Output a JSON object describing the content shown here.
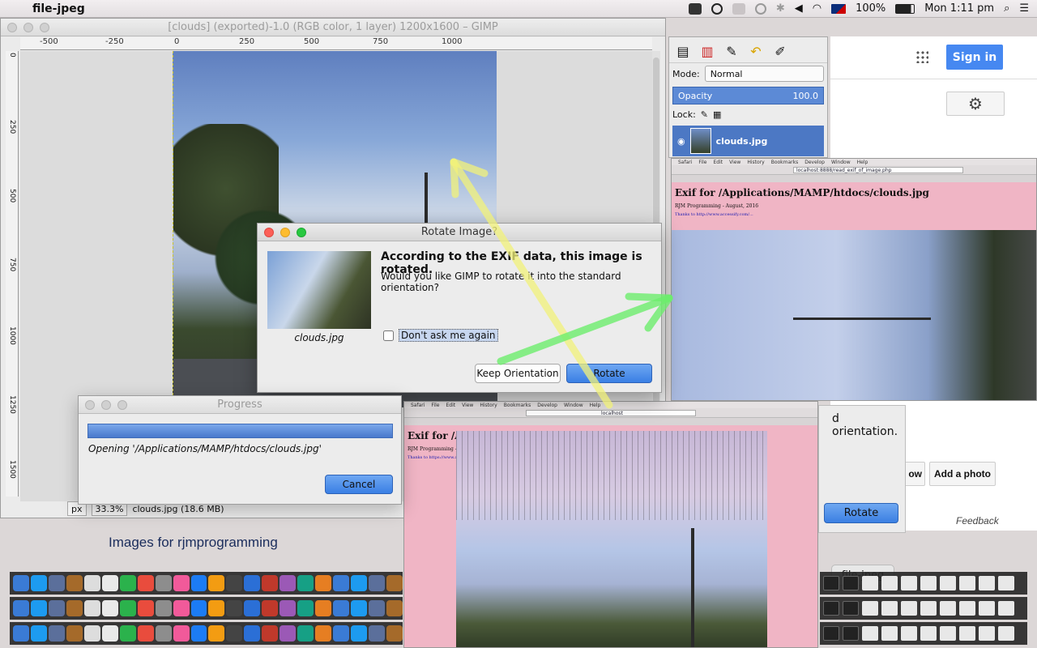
{
  "menubar": {
    "app_name": "file-jpeg",
    "battery": "100%",
    "clock": "Mon 1:11 pm"
  },
  "gimp": {
    "title": "[clouds] (exported)-1.0 (RGB color, 1 layer) 1200x1600 – GIMP",
    "ruler_top": [
      "-500",
      "-250",
      "0",
      "250",
      "500",
      "750",
      "1000"
    ],
    "ruler_left": [
      "0",
      "250",
      "500",
      "750",
      "1000",
      "1250",
      "1500"
    ],
    "unit": "px",
    "zoom": "33.3%",
    "status": "clouds.jpg (18.6 MB)"
  },
  "dock": {
    "mode_label": "Mode:",
    "mode_value": "Normal",
    "opacity_label": "Opacity",
    "opacity_value": "100.0",
    "lock_label": "Lock:",
    "layer_name": "clouds.jpg"
  },
  "rotate_dialog": {
    "title": "Rotate Image?",
    "heading": "According to the EXIF data, this image is rotated.",
    "question": "Would you like GIMP to rotate it into the standard orientation?",
    "filename": "clouds.jpg",
    "dont_ask": "Don't ask me again",
    "keep_button": "Keep Orientation",
    "rotate_button": "Rotate"
  },
  "progress_dialog": {
    "title": "Progress",
    "message": "Opening '/Applications/MAMP/htdocs/clouds.jpg'",
    "cancel_button": "Cancel"
  },
  "browser_bg": {
    "signin": "Sign in",
    "add_photo": "Add a photo",
    "feedback": "Feedback",
    "partial_orientation": "d orientation.",
    "partial_button": "ow",
    "rotate_button": "Rotate"
  },
  "shot1": {
    "url": "localhost:8888/read_exif_of_image.php",
    "heading": "Exif for /Applications/MAMP/htdocs/clouds.jpg",
    "byline": "RJM Programming - August, 2016",
    "thanks": "Thanks to http://www.accessify.com/..."
  },
  "shot2": {
    "url": "localhost",
    "heading": "Exif for /Appli",
    "byline": "RJM Programming - A",
    "thanks": "Thanks to https://www.acce"
  },
  "images_text": "Images for rjmprogramming",
  "tooltip": "file-jpeg",
  "colors": {
    "arrow_yellow": "#f2f27a",
    "arrow_green": "#6dee6d",
    "accent_blue": "#3a7fe4",
    "pink": "#f0b5c5"
  }
}
